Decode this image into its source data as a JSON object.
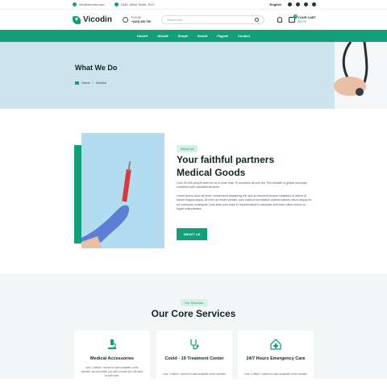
{
  "topbar": {
    "email": "info@vicodin.com",
    "location": "2345, West Tower, NYC",
    "language": "English",
    "socials": [
      "facebook-icon",
      "twitter-icon",
      "instagram-icon",
      "linkedin-icon"
    ]
  },
  "header": {
    "logo_text": "Vicodin",
    "phone_label": "PHONE",
    "phone_number": "+(323) 456 789",
    "search_placeholder": "Search here...",
    "cart_title": "YOUR CART",
    "cart_amount": "$00.00",
    "cart_count": "0"
  },
  "nav": {
    "items": [
      "Home",
      "About",
      "Shop",
      "News",
      "Pages",
      "Contact"
    ]
  },
  "hero": {
    "title": "What We Do",
    "breadcrumb_home": "Home",
    "breadcrumb_sep": "/",
    "breadcrumb_current": "Service"
  },
  "about": {
    "tag": "About Us",
    "heading_line1": "Your faithful partners",
    "heading_line2": "Medical Goods",
    "para1": "Over 39,000 people work for us in more than 70 countries all over the This breadth of global coverage, combined with specialist services",
    "para2": "Lorem ipsum dolor sit amet, consectetur adipiscing elit, sed do eiusmod tempor incididunt ut labore et dolore magna aliqua. Ut enim ad minim veniam, quis nostrud exercitation ullamco laboris nisi ut aliquip ex ea commodo consequat. Duis aute irure dolor in reprehenderit in voluptate velit esse cillum dolore eu fugiat nulla pariatur.",
    "button": "ABOUT US"
  },
  "services": {
    "tag": "Our Services",
    "heading": "Our Core Services",
    "cards": [
      {
        "icon": "microscope-icon",
        "title": "Medical Accessories",
        "desc": "over 1 million+ homes for sale available on the website, we can match you with a house you will want to call home."
      },
      {
        "icon": "stethoscope-icon",
        "title": "Covid - 19 Treatment Center",
        "desc": "over 1 million+ homes for sale available on the website"
      },
      {
        "icon": "home-cross-icon",
        "title": "24/7 Hours Emergency Care",
        "desc": "over 1 million+ homes for sale available on the website"
      }
    ]
  },
  "colors": {
    "accent": "#11a07a",
    "hero_bg": "#cde4ec",
    "dark": "#0f2624"
  }
}
